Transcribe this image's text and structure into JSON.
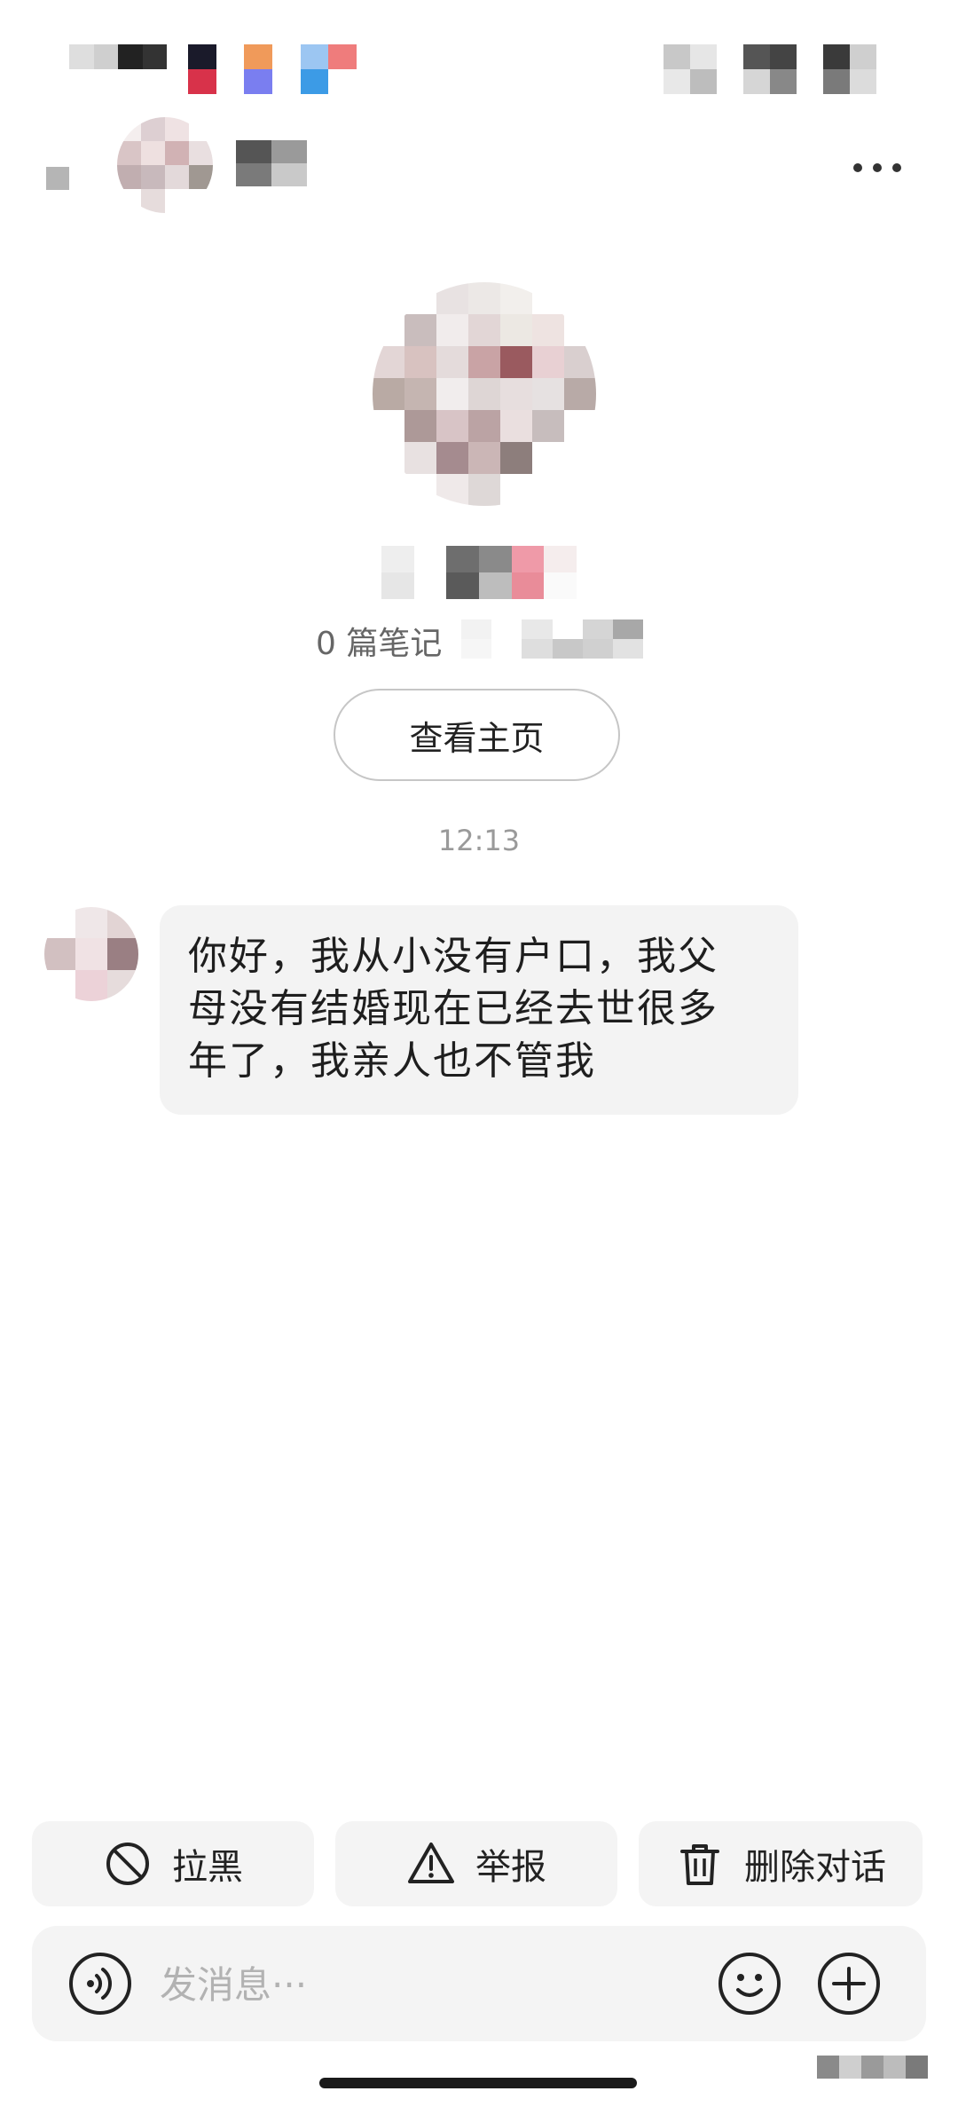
{
  "header": {
    "more_icon": "more-horizontal-icon"
  },
  "profile": {
    "notes_count": "0 篇笔记",
    "view_home_label": "查看主页"
  },
  "chat": {
    "timestamp": "12:13",
    "messages": [
      {
        "lines": [
          "你好，我从小没有户口，我父",
          "母没有结婚现在已经去世很多",
          "年了，我亲人也不管我"
        ]
      }
    ]
  },
  "actions": {
    "block_label": "拉黑",
    "report_label": "举报",
    "delete_label": "删除对话"
  },
  "composer": {
    "placeholder": "发消息···"
  },
  "colors": {
    "background": "#ffffff",
    "bubble": "#f3f3f3",
    "button_bg": "#f4f4f4",
    "muted_text": "#9a9a9a",
    "placeholder": "#b2b2b2"
  }
}
